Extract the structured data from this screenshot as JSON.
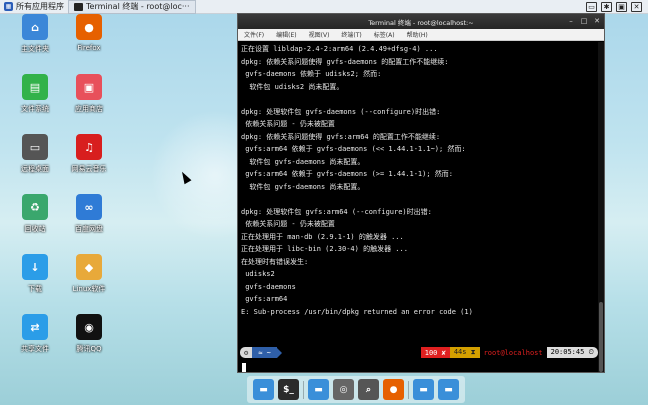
{
  "top_panel": {
    "apps_menu_label": "所有应用程序",
    "task_label": "Terminal 终端 - root@loc···"
  },
  "desktop_icons": [
    {
      "label": "主文件夹",
      "icon": "home-folder-icon",
      "color": "#3b87d8"
    },
    {
      "label": "Firefox",
      "icon": "firefox-icon",
      "color": "#e66000"
    },
    {
      "label": "文件系统",
      "icon": "filesystem-icon",
      "color": "#32b24a"
    },
    {
      "label": "应用商店",
      "icon": "app-store-icon",
      "color": "#e8505b"
    },
    {
      "label": "远程桌面",
      "icon": "remote-desktop-icon",
      "color": "#555555"
    },
    {
      "label": "网易云音乐",
      "icon": "netease-music-icon",
      "color": "#d81e1e"
    },
    {
      "label": "回收站",
      "icon": "trash-icon",
      "color": "#3aa76d"
    },
    {
      "label": "百度网盘",
      "icon": "baidu-disk-icon",
      "color": "#2f7bd6"
    },
    {
      "label": "下载",
      "icon": "download-folder-icon",
      "color": "#2b9de8"
    },
    {
      "label": "Linux软件",
      "icon": "software-icon",
      "color": "#e8a93a"
    },
    {
      "label": "共享文件",
      "icon": "share-folder-icon",
      "color": "#2b9de8"
    },
    {
      "label": "腾讯QQ",
      "icon": "qq-icon",
      "color": "#111111"
    }
  ],
  "terminal": {
    "title": "Terminal 终端 - root@localhost:~",
    "menu": [
      "文件(F)",
      "编辑(E)",
      "视图(V)",
      "终端(T)",
      "标签(A)",
      "帮助(H)"
    ],
    "lines": [
      "正在设置 libldap-2.4-2:arm64 (2.4.49+dfsg-4) ...",
      "dpkg: 依赖关系问题使得 gvfs-daemons 的配置工作不能继续:",
      " gvfs-daemons 依赖于 udisks2; 然而:",
      "  软件包 udisks2 尚未配置。",
      "",
      "dpkg: 处理软件包 gvfs-daemons (--configure)时出错:",
      " 依赖关系问题 - 仍未被配置",
      "dpkg: 依赖关系问题使得 gvfs:arm64 的配置工作不能继续:",
      " gvfs:arm64 依赖于 gvfs-daemons (<< 1.44.1-1.1~); 然而:",
      "  软件包 gvfs-daemons 尚未配置。",
      " gvfs:arm64 依赖于 gvfs-daemons (>= 1.44.1-1); 然而:",
      "  软件包 gvfs-daemons 尚未配置。",
      "",
      "dpkg: 处理软件包 gvfs:arm64 (--configure)时出错:",
      " 依赖关系问题 - 仍未被配置",
      "正在处理用于 man-db (2.9.1-1) 的触发器 ...",
      "正在处理用于 libc-bin (2.30-4) 的触发器 ...",
      "在处理时有错误发生:",
      " udisks2",
      " gvfs-daemons",
      " gvfs:arm64",
      "E: Sub-process /usr/bin/dpkg returned an error code (1)"
    ],
    "prompt": {
      "left1": "⚙",
      "left2": "≈ ~",
      "error": "100 ✘",
      "elapsed": "44s ⧗",
      "host": "root@localhost",
      "clock": "20:05:45 ⏲"
    }
  },
  "dock": [
    {
      "icon": "folder-icon",
      "color": "#3a8fd9"
    },
    {
      "icon": "terminal-icon",
      "color": "#2b2b2b"
    },
    {
      "icon": "file-manager-icon",
      "color": "#3a8fd9"
    },
    {
      "icon": "network-icon",
      "color": "#666666"
    },
    {
      "icon": "search-icon",
      "color": "#555555"
    },
    {
      "icon": "firefox-icon",
      "color": "#e66000"
    },
    {
      "icon": "folder-icon",
      "color": "#3a8fd9"
    },
    {
      "icon": "folder-icon",
      "color": "#3a8fd9"
    }
  ]
}
